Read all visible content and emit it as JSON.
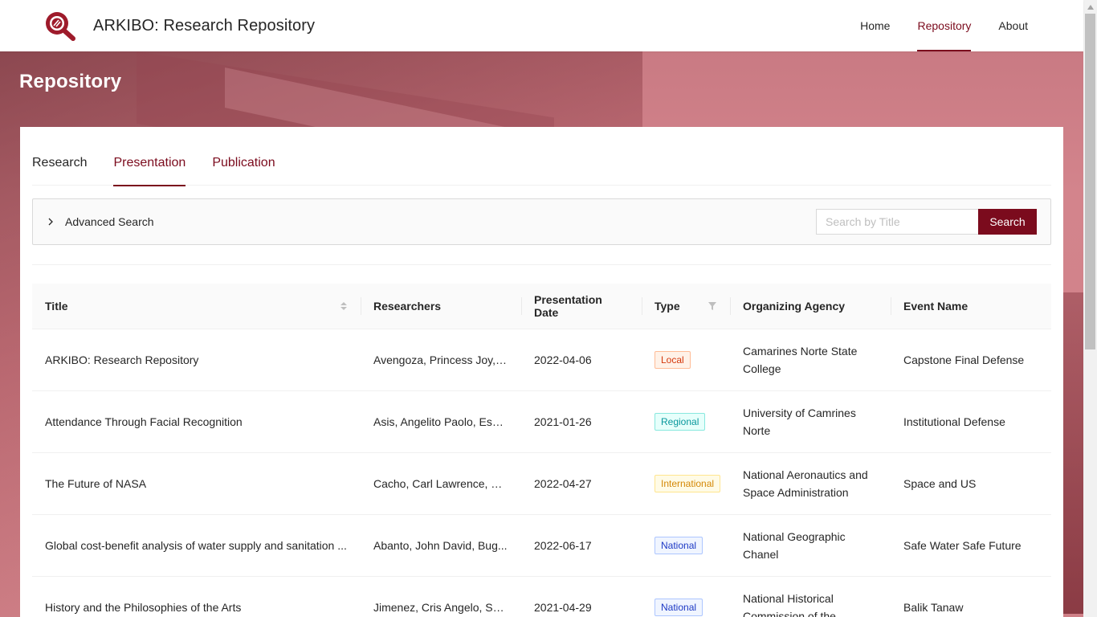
{
  "header": {
    "title": "ARKIBO: Research Repository",
    "nav": [
      {
        "label": "Home",
        "active": false
      },
      {
        "label": "Repository",
        "active": true
      },
      {
        "label": "About",
        "active": false
      }
    ]
  },
  "page": {
    "title": "Repository"
  },
  "tabs": [
    {
      "label": "Research"
    },
    {
      "label": "Presentation",
      "active": true
    },
    {
      "label": "Publication"
    }
  ],
  "advanced_search": {
    "label": "Advanced Search",
    "expanded": false
  },
  "search": {
    "placeholder": "Search by Title",
    "value": "",
    "button_label": "Search"
  },
  "table": {
    "columns": [
      "Title",
      "Researchers",
      "Presentation Date",
      "Type",
      "Organizing Agency",
      "Event Name"
    ],
    "rows": [
      {
        "title": "ARKIBO: Research Repository",
        "researchers": "Avengoza, Princess Joy, L...",
        "date": "2022-04-06",
        "type": "Local",
        "agency": "Camarines Norte State College",
        "event": "Capstone Final Defense"
      },
      {
        "title": "Attendance Through Facial Recognition",
        "researchers": "Asis, Angelito Paolo, Esm...",
        "date": "2021-01-26",
        "type": "Regional",
        "agency": "University of Camrines Norte",
        "event": "Institutional Defense"
      },
      {
        "title": "The Future of NASA",
        "researchers": "Cacho, Carl Lawrence, Me...",
        "date": "2022-04-27",
        "type": "International",
        "agency": "National Aeronautics and Space Administration",
        "event": "Space and US"
      },
      {
        "title": "Global cost-benefit analysis of water supply and sanitation ...",
        "researchers": "Abanto, John David, Bug...",
        "date": "2022-06-17",
        "type": "National",
        "agency": "National Geographic Chanel",
        "event": "Safe Water Safe Future"
      },
      {
        "title": "History and the Philosophies of the Arts",
        "researchers": "Jimenez, Cris Angelo, Sen...",
        "date": "2021-04-29",
        "type": "National",
        "agency": "National Historical Commission of the",
        "event": "Balik Tanaw"
      }
    ]
  },
  "colors": {
    "brand": "#7b0b1d",
    "tag_local": "#d4380d",
    "tag_regional": "#08979c",
    "tag_international": "#d48806",
    "tag_national": "#1d39c4"
  },
  "icons": {
    "logo": "magnifier-logo-icon",
    "advanced_search_toggle": "chevron-right-icon",
    "title_sort": "sort-icon",
    "type_filter": "filter-icon"
  }
}
